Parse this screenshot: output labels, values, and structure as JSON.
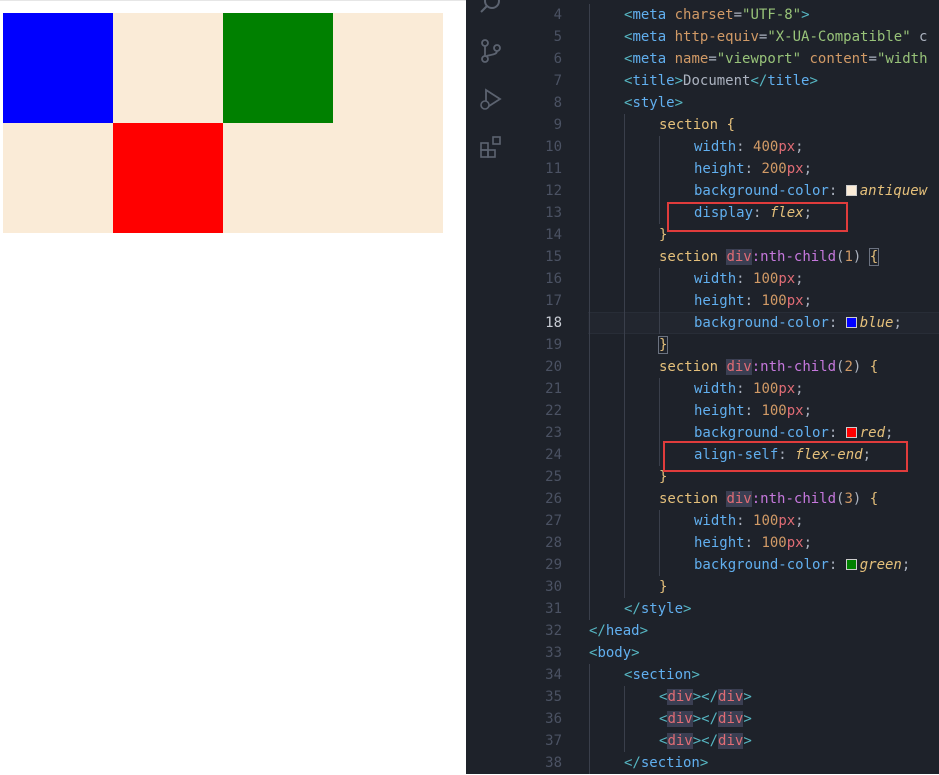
{
  "preview": {
    "boxes": [
      {
        "name": "blue",
        "color": "#0000ff"
      },
      {
        "name": "red",
        "color": "#ff0000"
      },
      {
        "name": "green",
        "color": "#008000"
      }
    ],
    "section_color": "#faebd7"
  },
  "editor": {
    "active_line": 18,
    "activity_icons": [
      "search-icon",
      "source-control-icon",
      "run-debug-icon",
      "extensions-icon"
    ],
    "lines": [
      {
        "n": 4,
        "indent": 1,
        "tokens": [
          [
            "punc",
            "<"
          ],
          [
            "tagb",
            "meta"
          ],
          [
            "text",
            " "
          ],
          [
            "attr",
            "charset"
          ],
          [
            "text",
            "="
          ],
          [
            "str",
            "\"UTF-8\""
          ],
          [
            "punc",
            ">"
          ]
        ]
      },
      {
        "n": 5,
        "indent": 1,
        "tokens": [
          [
            "punc",
            "<"
          ],
          [
            "tagb",
            "meta"
          ],
          [
            "text",
            " "
          ],
          [
            "attr",
            "http-equiv"
          ],
          [
            "text",
            "="
          ],
          [
            "str",
            "\"X-UA-Compatible\""
          ],
          [
            "text",
            " c"
          ]
        ]
      },
      {
        "n": 6,
        "indent": 1,
        "tokens": [
          [
            "punc",
            "<"
          ],
          [
            "tagb",
            "meta"
          ],
          [
            "text",
            " "
          ],
          [
            "attr",
            "name"
          ],
          [
            "text",
            "="
          ],
          [
            "str",
            "\"viewport\""
          ],
          [
            "text",
            " "
          ],
          [
            "attr",
            "content"
          ],
          [
            "text",
            "="
          ],
          [
            "str",
            "\"width"
          ]
        ]
      },
      {
        "n": 7,
        "indent": 1,
        "tokens": [
          [
            "punc",
            "<"
          ],
          [
            "tagb",
            "title"
          ],
          [
            "punc",
            ">"
          ],
          [
            "text",
            "Document"
          ],
          [
            "punc",
            "</"
          ],
          [
            "tagb",
            "title"
          ],
          [
            "punc",
            ">"
          ]
        ]
      },
      {
        "n": 8,
        "indent": 1,
        "tokens": [
          [
            "punc",
            "<"
          ],
          [
            "tagb",
            "style"
          ],
          [
            "punc",
            ">"
          ]
        ]
      },
      {
        "n": 9,
        "indent": 2,
        "tokens": [
          [
            "sel",
            "section"
          ],
          [
            "text",
            " "
          ],
          [
            "brace",
            "{"
          ]
        ]
      },
      {
        "n": 10,
        "indent": 3,
        "tokens": [
          [
            "prop",
            "width"
          ],
          [
            "pun2",
            ": "
          ],
          [
            "num",
            "400"
          ],
          [
            "unit",
            "px"
          ],
          [
            "pun2",
            ";"
          ]
        ]
      },
      {
        "n": 11,
        "indent": 3,
        "tokens": [
          [
            "prop",
            "height"
          ],
          [
            "pun2",
            ": "
          ],
          [
            "num",
            "200"
          ],
          [
            "unit",
            "px"
          ],
          [
            "pun2",
            ";"
          ]
        ]
      },
      {
        "n": 12,
        "indent": 3,
        "tokens": [
          [
            "prop",
            "background-color"
          ],
          [
            "pun2",
            ": "
          ],
          [
            "swatch",
            "#faebd7"
          ],
          [
            "val",
            "antiquew"
          ]
        ]
      },
      {
        "n": 13,
        "indent": 3,
        "tokens": [
          [
            "prop",
            "display"
          ],
          [
            "pun2",
            ": "
          ],
          [
            "val",
            "flex"
          ],
          [
            "pun2",
            ";"
          ]
        ]
      },
      {
        "n": 14,
        "indent": 2,
        "tokens": [
          [
            "brace",
            "}"
          ]
        ]
      },
      {
        "n": 15,
        "indent": 2,
        "tokens": [
          [
            "sel",
            "section"
          ],
          [
            "text",
            " "
          ],
          [
            "div",
            "div"
          ],
          [
            "pseudo",
            ":nth-child"
          ],
          [
            "pun2",
            "("
          ],
          [
            "num",
            "1"
          ],
          [
            "pun2",
            ")"
          ],
          [
            "text",
            " "
          ],
          [
            "brace",
            "{"
          ]
        ]
      },
      {
        "n": 16,
        "indent": 3,
        "tokens": [
          [
            "prop",
            "width"
          ],
          [
            "pun2",
            ": "
          ],
          [
            "num",
            "100"
          ],
          [
            "unit",
            "px"
          ],
          [
            "pun2",
            ";"
          ]
        ]
      },
      {
        "n": 17,
        "indent": 3,
        "tokens": [
          [
            "prop",
            "height"
          ],
          [
            "pun2",
            ": "
          ],
          [
            "num",
            "100"
          ],
          [
            "unit",
            "px"
          ],
          [
            "pun2",
            ";"
          ]
        ]
      },
      {
        "n": 18,
        "indent": 3,
        "tokens": [
          [
            "prop",
            "background-color"
          ],
          [
            "pun2",
            ": "
          ],
          [
            "swatch",
            "#0000ff"
          ],
          [
            "val",
            "blue"
          ],
          [
            "pun2",
            ";"
          ]
        ]
      },
      {
        "n": 19,
        "indent": 2,
        "tokens": [
          [
            "brace",
            "}"
          ]
        ]
      },
      {
        "n": 20,
        "indent": 2,
        "tokens": [
          [
            "sel",
            "section"
          ],
          [
            "text",
            " "
          ],
          [
            "div",
            "div"
          ],
          [
            "pseudo",
            ":nth-child"
          ],
          [
            "pun2",
            "("
          ],
          [
            "num",
            "2"
          ],
          [
            "pun2",
            ")"
          ],
          [
            "text",
            " "
          ],
          [
            "brace",
            "{"
          ]
        ]
      },
      {
        "n": 21,
        "indent": 3,
        "tokens": [
          [
            "prop",
            "width"
          ],
          [
            "pun2",
            ": "
          ],
          [
            "num",
            "100"
          ],
          [
            "unit",
            "px"
          ],
          [
            "pun2",
            ";"
          ]
        ]
      },
      {
        "n": 22,
        "indent": 3,
        "tokens": [
          [
            "prop",
            "height"
          ],
          [
            "pun2",
            ": "
          ],
          [
            "num",
            "100"
          ],
          [
            "unit",
            "px"
          ],
          [
            "pun2",
            ";"
          ]
        ]
      },
      {
        "n": 23,
        "indent": 3,
        "tokens": [
          [
            "prop",
            "background-color"
          ],
          [
            "pun2",
            ": "
          ],
          [
            "swatch",
            "#ff0000"
          ],
          [
            "val",
            "red"
          ],
          [
            "pun2",
            ";"
          ]
        ]
      },
      {
        "n": 24,
        "indent": 3,
        "tokens": [
          [
            "prop",
            "align-self"
          ],
          [
            "pun2",
            ": "
          ],
          [
            "val",
            "flex-end"
          ],
          [
            "pun2",
            ";"
          ]
        ]
      },
      {
        "n": 25,
        "indent": 2,
        "tokens": [
          [
            "brace",
            "}"
          ]
        ]
      },
      {
        "n": 26,
        "indent": 2,
        "tokens": [
          [
            "sel",
            "section"
          ],
          [
            "text",
            " "
          ],
          [
            "div",
            "div"
          ],
          [
            "pseudo",
            ":nth-child"
          ],
          [
            "pun2",
            "("
          ],
          [
            "num",
            "3"
          ],
          [
            "pun2",
            ")"
          ],
          [
            "text",
            " "
          ],
          [
            "brace",
            "{"
          ]
        ]
      },
      {
        "n": 27,
        "indent": 3,
        "tokens": [
          [
            "prop",
            "width"
          ],
          [
            "pun2",
            ": "
          ],
          [
            "num",
            "100"
          ],
          [
            "unit",
            "px"
          ],
          [
            "pun2",
            ";"
          ]
        ]
      },
      {
        "n": 28,
        "indent": 3,
        "tokens": [
          [
            "prop",
            "height"
          ],
          [
            "pun2",
            ": "
          ],
          [
            "num",
            "100"
          ],
          [
            "unit",
            "px"
          ],
          [
            "pun2",
            ";"
          ]
        ]
      },
      {
        "n": 29,
        "indent": 3,
        "tokens": [
          [
            "prop",
            "background-color"
          ],
          [
            "pun2",
            ": "
          ],
          [
            "swatch",
            "#008000"
          ],
          [
            "val",
            "green"
          ],
          [
            "pun2",
            ";"
          ]
        ]
      },
      {
        "n": 30,
        "indent": 2,
        "tokens": [
          [
            "brace",
            "}"
          ]
        ]
      },
      {
        "n": 31,
        "indent": 1,
        "tokens": [
          [
            "punc",
            "</"
          ],
          [
            "tagb",
            "style"
          ],
          [
            "punc",
            ">"
          ]
        ]
      },
      {
        "n": 32,
        "indent": 0,
        "tokens": [
          [
            "punc",
            "</"
          ],
          [
            "tagb",
            "head"
          ],
          [
            "punc",
            ">"
          ]
        ]
      },
      {
        "n": 33,
        "indent": 0,
        "tokens": [
          [
            "punc",
            "<"
          ],
          [
            "tagb",
            "body"
          ],
          [
            "punc",
            ">"
          ]
        ]
      },
      {
        "n": 34,
        "indent": 1,
        "tokens": [
          [
            "punc",
            "<"
          ],
          [
            "tagb",
            "section"
          ],
          [
            "punc",
            ">"
          ]
        ]
      },
      {
        "n": 35,
        "indent": 2,
        "tokens": [
          [
            "punc",
            "<"
          ],
          [
            "div",
            "div"
          ],
          [
            "punc",
            "></"
          ],
          [
            "div",
            "div"
          ],
          [
            "punc",
            ">"
          ]
        ]
      },
      {
        "n": 36,
        "indent": 2,
        "tokens": [
          [
            "punc",
            "<"
          ],
          [
            "div",
            "div"
          ],
          [
            "punc",
            "></"
          ],
          [
            "div",
            "div"
          ],
          [
            "punc",
            ">"
          ]
        ]
      },
      {
        "n": 37,
        "indent": 2,
        "tokens": [
          [
            "punc",
            "<"
          ],
          [
            "div",
            "div"
          ],
          [
            "punc",
            "></"
          ],
          [
            "div",
            "div"
          ],
          [
            "punc",
            ">"
          ]
        ]
      },
      {
        "n": 38,
        "indent": 1,
        "tokens": [
          [
            "punc",
            "</"
          ],
          [
            "tagb",
            "section"
          ],
          [
            "punc",
            ">"
          ]
        ]
      }
    ]
  }
}
